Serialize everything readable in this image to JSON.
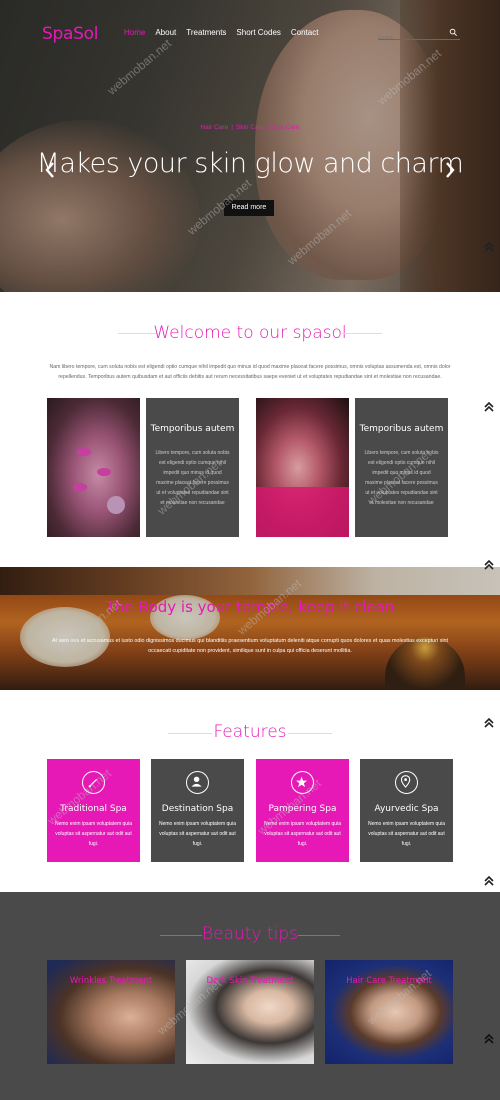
{
  "header": {
    "logo": "SpaSol",
    "nav": [
      "Home",
      "About",
      "Treatments",
      "Short Codes",
      "Contact"
    ],
    "search_placeholder": "Search"
  },
  "hero": {
    "breadcrumbs": [
      "Hair Care",
      "Skin Care",
      "Spa Care"
    ],
    "title": "Makes your skin glow and charm",
    "read_more": "Read more"
  },
  "welcome": {
    "title": "Welcome to our spasol",
    "text": "Nam libero tempore, cum soluta nobis est eligendi optio cumque nihil impedit quo minus id quod maxime placeat facere possimus, omnis voluptas assumenda est, omnis dolor repellendus. Temporibus autem quibusdam et aut officiis debitis aut rerum necessitatibus saepe eveniet ut et voluptates repudiandae sint et molestiae non recusandae.",
    "cards": [
      {
        "title": "Temporibus autem",
        "text": "Libero tempore, cum soluta nobis est eligendi optio cumque nihil impedit quo minus id quod maxime placeat facere possimus ut et voluptates repudiandae sint et molestiae non recusandae"
      },
      {
        "title": "Temporibus autem",
        "text": "Libero tempore, cum soluta nobis est eligendi optio cumque nihil impedit quo minus id quod maxime placeat facere possimus ut et voluptates repudiandae sint et molestiae non recusandae"
      }
    ]
  },
  "temple": {
    "title": "The Body is your temple, keep it clean",
    "text": "At vero eos et accusamus et iusto odio dignissimos ducimus qui blanditiis praesentium voluptatum deleniti atque corrupti quos dolores et quas molestias excepturi sint occaecati cupiditate non provident, similique sunt in culpa qui officia deserunt mollitia."
  },
  "features": {
    "title": "Features",
    "items": [
      {
        "name": "Traditional Spa",
        "icon": "brush-icon",
        "text": "Nemo enim ipsam voluptatem quia voluptas sit aspernatur aut odit aut fugi."
      },
      {
        "name": "Destination Spa",
        "icon": "user-icon",
        "text": "Nemo enim ipsam voluptatem quia voluptas sit aspernatur aut odit aut fugi."
      },
      {
        "name": "Pampering Spa",
        "icon": "star-icon",
        "text": "Nemo enim ipsam voluptatem quia voluptas sit aspernatur aut odit aut fugi."
      },
      {
        "name": "Ayurvedic Spa",
        "icon": "map-pin-icon",
        "text": "Nemo enim ipsam voluptatem quia voluptas sit aspernatur aut odit aut fugi."
      }
    ]
  },
  "tips": {
    "title": "Beauty tips",
    "items": [
      "Wrinkles Treatment",
      "Dark Skin Treatment",
      "Hair Care Treatment"
    ]
  },
  "watermark": "webmoban.net",
  "colors": {
    "accent": "#e619b7",
    "dark": "#4a4a4a"
  }
}
